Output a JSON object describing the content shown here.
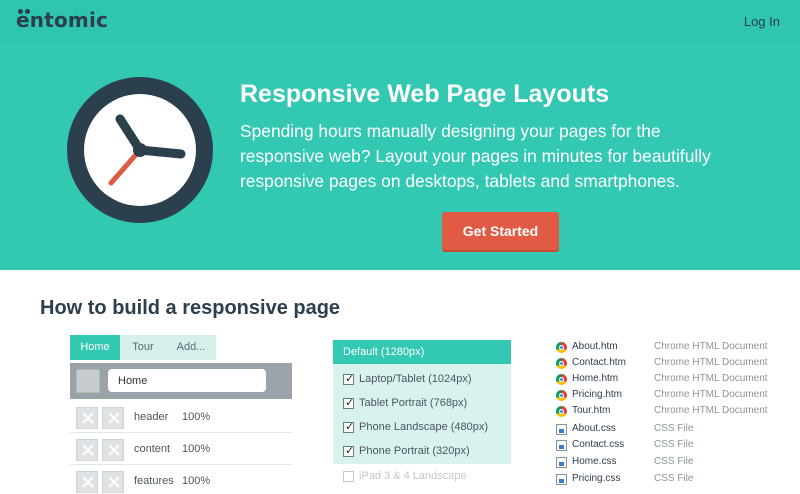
{
  "header": {
    "logo": "entomic",
    "login_label": "Log In"
  },
  "hero": {
    "title": "Responsive Web Page Layouts",
    "text": "Spending hours manually designing your pages for the responsive web? Layout your pages in minutes for beautifully responsive pages on desktops, tablets and smartphones.",
    "cta_label": "Get Started"
  },
  "section": {
    "title": "How to build a responsive page"
  },
  "editor": {
    "tabs": [
      {
        "label": "Home"
      },
      {
        "label": "Tour"
      },
      {
        "label": "Add..."
      }
    ],
    "nav_value": "Home",
    "rows": [
      {
        "name": "header",
        "pct": "100%"
      },
      {
        "name": "content",
        "pct": "100%"
      },
      {
        "name": "features",
        "pct": "100%"
      }
    ]
  },
  "breakpoints": {
    "header": "Default (1280px)",
    "items": [
      {
        "label": "Laptop/Tablet (1024px)",
        "checked": true
      },
      {
        "label": "Tablet Portrait (768px)",
        "checked": true
      },
      {
        "label": "Phone Landscape (480px)",
        "checked": true
      },
      {
        "label": "Phone Portrait (320px)",
        "checked": true
      },
      {
        "label": "iPad 3 & 4 Landscape",
        "checked": false
      }
    ]
  },
  "files": [
    {
      "name": "About.htm",
      "type": "Chrome HTML Document",
      "icon": "chrome-icon"
    },
    {
      "name": "Contact.htm",
      "type": "Chrome HTML Document",
      "icon": "chrome-icon"
    },
    {
      "name": "Home.htm",
      "type": "Chrome HTML Document",
      "icon": "chrome-icon"
    },
    {
      "name": "Pricing.htm",
      "type": "Chrome HTML Document",
      "icon": "chrome-icon"
    },
    {
      "name": "Tour.htm",
      "type": "Chrome HTML Document",
      "icon": "chrome-icon"
    },
    {
      "name": "About.css",
      "type": "CSS File",
      "icon": "css-file-icon"
    },
    {
      "name": "Contact.css",
      "type": "CSS File",
      "icon": "css-file-icon"
    },
    {
      "name": "Home.css",
      "type": "CSS File",
      "icon": "css-file-icon"
    },
    {
      "name": "Pricing.css",
      "type": "CSS File",
      "icon": "css-file-icon"
    }
  ],
  "colors": {
    "brand_teal": "#33c8b2",
    "header_teal": "#2fc5b0",
    "cta_red": "#e05a44",
    "dark_navy": "#2b3f4c"
  }
}
